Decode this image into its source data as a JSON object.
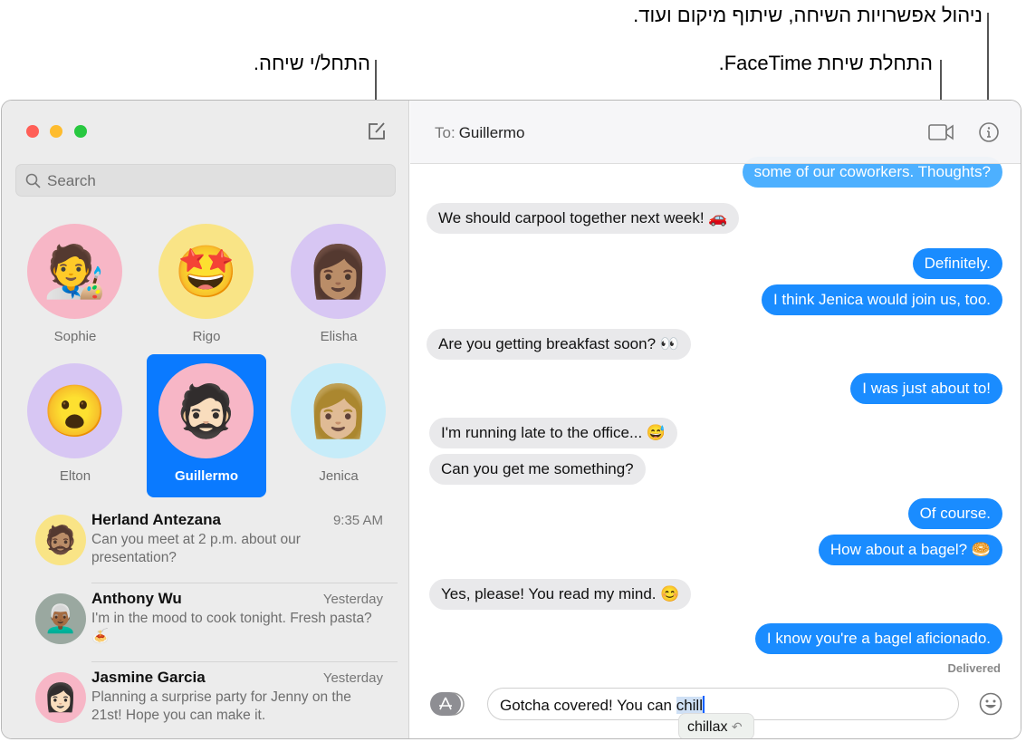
{
  "callouts": {
    "manage": "ניהול אפשרויות השיחה, שיתוף מיקום ועוד.",
    "facetime": "התחלת שיחת FaceTime.",
    "compose": "התחל/י שיחה."
  },
  "sidebar": {
    "search_placeholder": "Search",
    "pinned": [
      {
        "name": "Sophie",
        "emoji": "🧑‍🎨",
        "color": "#f7b6c6"
      },
      {
        "name": "Rigo",
        "emoji": "🤩",
        "color": "#f9e486"
      },
      {
        "name": "Elisha",
        "emoji": "👩🏽",
        "color": "#d7c6f3"
      },
      {
        "name": "Elton",
        "emoji": "😮",
        "color": "#d7c6f3"
      },
      {
        "name": "Guillermo",
        "emoji": "🧔🏻",
        "color": "#f7b6c6",
        "selected": true
      },
      {
        "name": "Jenica",
        "emoji": "👩🏼",
        "color": "#c6ecf9"
      }
    ],
    "conversations": [
      {
        "name": "Herland Antezana",
        "time": "9:35 AM",
        "preview": "Can you meet at 2 p.m. about our presentation?",
        "emoji": "🧔🏽",
        "color": "#f9e486"
      },
      {
        "name": "Anthony Wu",
        "time": "Yesterday",
        "preview": "I'm in the mood to cook tonight. Fresh pasta? 🍝",
        "emoji": "👨🏾‍🦳",
        "color": "#9aa8a0"
      },
      {
        "name": "Jasmine Garcia",
        "time": "Yesterday",
        "preview": "Planning a surprise party for Jenny on the 21st! Hope you can make it.",
        "emoji": "👩🏻",
        "color": "#f7b6c6"
      }
    ]
  },
  "chat": {
    "to_label": "To:",
    "recipient": "Guillermo",
    "messages": [
      {
        "dir": "out",
        "text": "some of our coworkers. Thoughts?"
      },
      {
        "dir": "in",
        "text": "We should carpool together next week! 🚗"
      },
      {
        "dir": "out",
        "text": "Definitely."
      },
      {
        "dir": "out",
        "text": "I think Jenica would join us, too."
      },
      {
        "dir": "in",
        "text": "Are you getting breakfast soon? 👀"
      },
      {
        "dir": "out",
        "text": "I was just about to!"
      },
      {
        "dir": "in",
        "text": "I'm running late to the office... 😅"
      },
      {
        "dir": "in",
        "text": "Can you get me something?"
      },
      {
        "dir": "out",
        "text": "Of course."
      },
      {
        "dir": "out",
        "text": "How about a bagel? 🥯"
      },
      {
        "dir": "in",
        "text": "Yes, please! You read my mind. 😊"
      },
      {
        "dir": "out",
        "text": "I know you're a bagel aficionado."
      }
    ],
    "status": "Delivered",
    "input_text": "Gotcha covered! You can ",
    "input_highlight": "chill",
    "suggestion": "chillax"
  },
  "colors": {
    "accent": "#0a7aff",
    "bubble_out": "#1a8cff",
    "bubble_in": "#e9e9eb"
  }
}
